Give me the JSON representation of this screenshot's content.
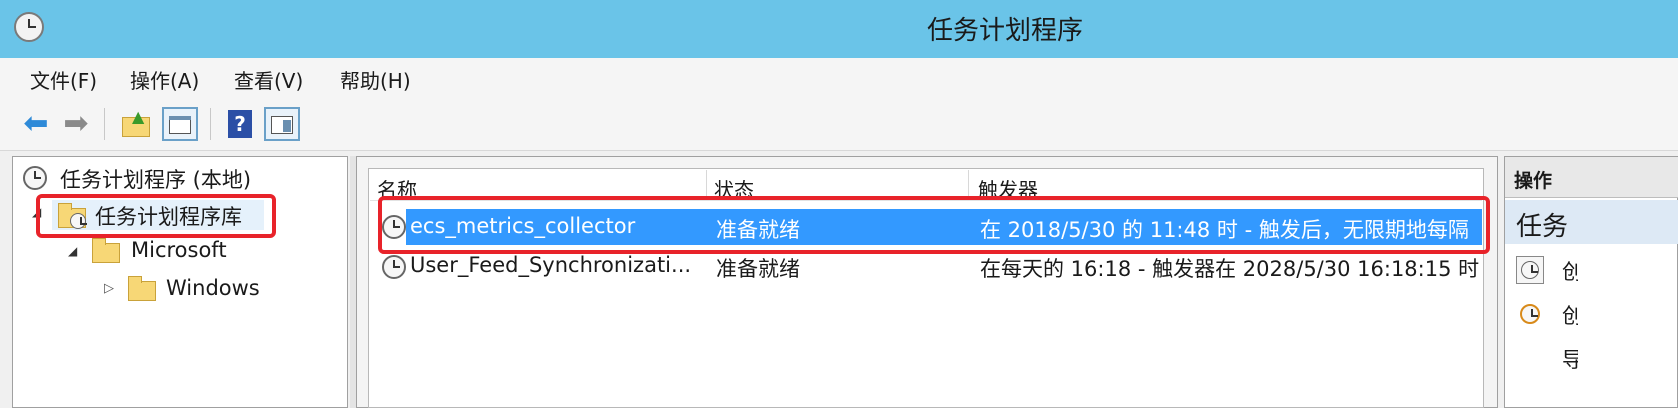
{
  "window": {
    "title": "任务计划程序"
  },
  "menu": {
    "items": [
      "文件(F)",
      "操作(A)",
      "查看(V)",
      "帮助(H)"
    ]
  },
  "tree": {
    "root": "任务计划程序 (本地)",
    "library": "任务计划程序库",
    "microsoft": "Microsoft",
    "windows": "Windows"
  },
  "table": {
    "columns": [
      "名称",
      "状态",
      "触发器"
    ],
    "rows": [
      {
        "name": "ecs_metrics_collector",
        "status": "准备就绪",
        "trigger": "在 2018/5/30 的 11:48 时 - 触发后，无限期地每隔"
      },
      {
        "name": "User_Feed_Synchronizati...",
        "status": "准备就绪",
        "trigger": "在每天的 16:18 - 触发器在 2028/5/30 16:18:15 时"
      }
    ]
  },
  "actions": {
    "header": "操作",
    "section": "任务",
    "item1": "创",
    "item2": "创",
    "item3": "导"
  },
  "colors": {
    "titlebar": "#6ac4e8",
    "selection": "#3399ff",
    "highlight": "#e8232a"
  }
}
